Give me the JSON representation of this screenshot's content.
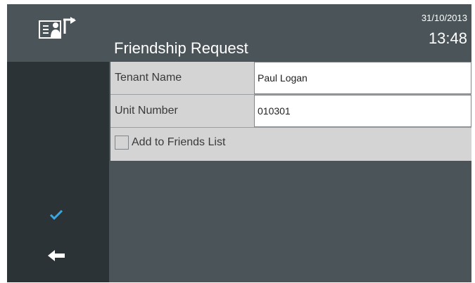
{
  "header": {
    "title": "Friendship Request",
    "date": "31/10/2013",
    "time": "13:48",
    "icon": "tenant-transfer-icon"
  },
  "form": {
    "tenant_name": {
      "label": "Tenant Name",
      "value": "Paul Logan"
    },
    "unit_number": {
      "label": "Unit Number",
      "value": "010301"
    },
    "add_to_friends": {
      "label": "Add to Friends List",
      "checked": false
    }
  },
  "sidebar": {
    "confirm_icon": "check-icon",
    "back_icon": "arrow-left-icon"
  },
  "colors": {
    "accent": "#3aa7e0",
    "header_bg": "#4a5459",
    "sidebar_bg": "#2c3336",
    "field_label_bg": "#d4d4d4"
  }
}
